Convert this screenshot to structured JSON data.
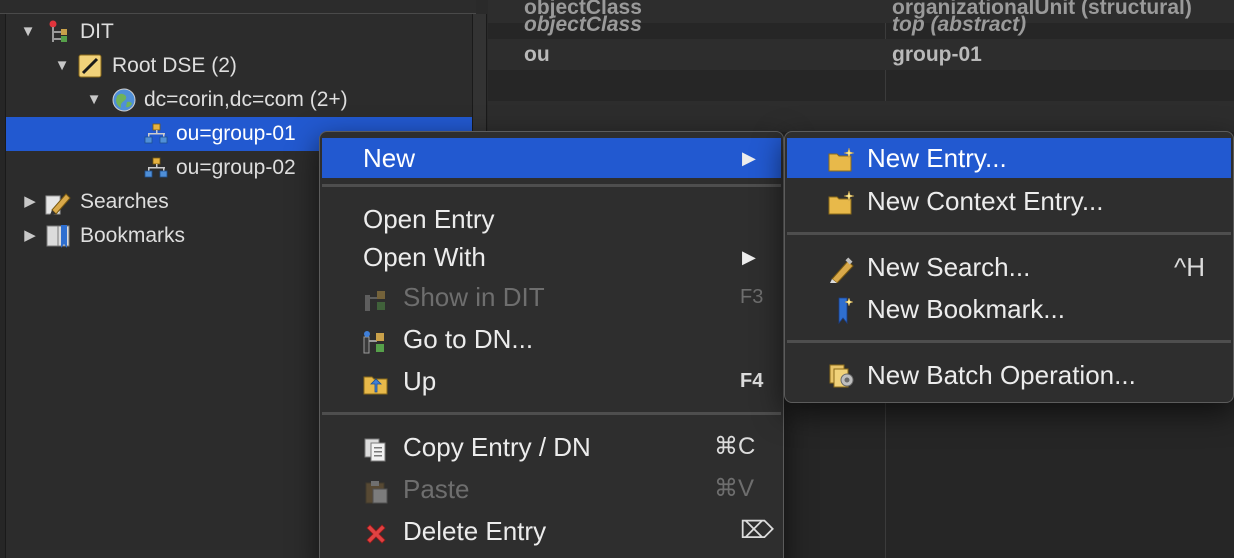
{
  "tree": {
    "items": [
      {
        "label": "DIT",
        "expanded": true,
        "icon": "dit-icon"
      },
      {
        "label": "Root DSE (2)",
        "expanded": true,
        "icon": "root-dse-icon"
      },
      {
        "label": "dc=corin,dc=com (2+)",
        "expanded": true,
        "icon": "globe-icon"
      },
      {
        "label": "ou=group-01",
        "selected": true,
        "icon": "org-unit-icon"
      },
      {
        "label": "ou=group-02",
        "icon": "org-unit-icon"
      },
      {
        "label": "Searches",
        "expanded": false,
        "icon": "search-pen-icon"
      },
      {
        "label": "Bookmarks",
        "expanded": false,
        "icon": "bookmark-icon"
      }
    ]
  },
  "attributes": {
    "rows": [
      {
        "name": "objectClass",
        "value": "organizationalUnit (structural)"
      },
      {
        "name": "objectClass",
        "value": "top (abstract)"
      },
      {
        "name": "ou",
        "value": "group-01"
      }
    ]
  },
  "context_menu": {
    "new": {
      "label": "New"
    },
    "open_entry": {
      "label": "Open Entry"
    },
    "open_with": {
      "label": "Open With"
    },
    "show_in_dit": {
      "label": "Show in DIT",
      "shortcut": "F3",
      "disabled": true
    },
    "go_to_dn": {
      "label": "Go to DN..."
    },
    "up": {
      "label": "Up",
      "shortcut": "F4"
    },
    "copy_entry": {
      "label": "Copy Entry / DN",
      "shortcut": "⌘C"
    },
    "paste": {
      "label": "Paste",
      "shortcut": "⌘V",
      "disabled": true
    },
    "delete_entry": {
      "label": "Delete Entry",
      "shortcut": "⌦"
    }
  },
  "submenu": {
    "new_entry": {
      "label": "New Entry..."
    },
    "new_context_entry": {
      "label": "New Context Entry..."
    },
    "new_search": {
      "label": "New Search...",
      "shortcut": "^H"
    },
    "new_bookmark": {
      "label": "New Bookmark..."
    },
    "new_batch_operation": {
      "label": "New Batch Operation..."
    }
  },
  "colors": {
    "selection": "#2259d0",
    "menu_bg": "#2e2e2e",
    "folder": "#e8b94a",
    "delete_red": "#e04242"
  }
}
